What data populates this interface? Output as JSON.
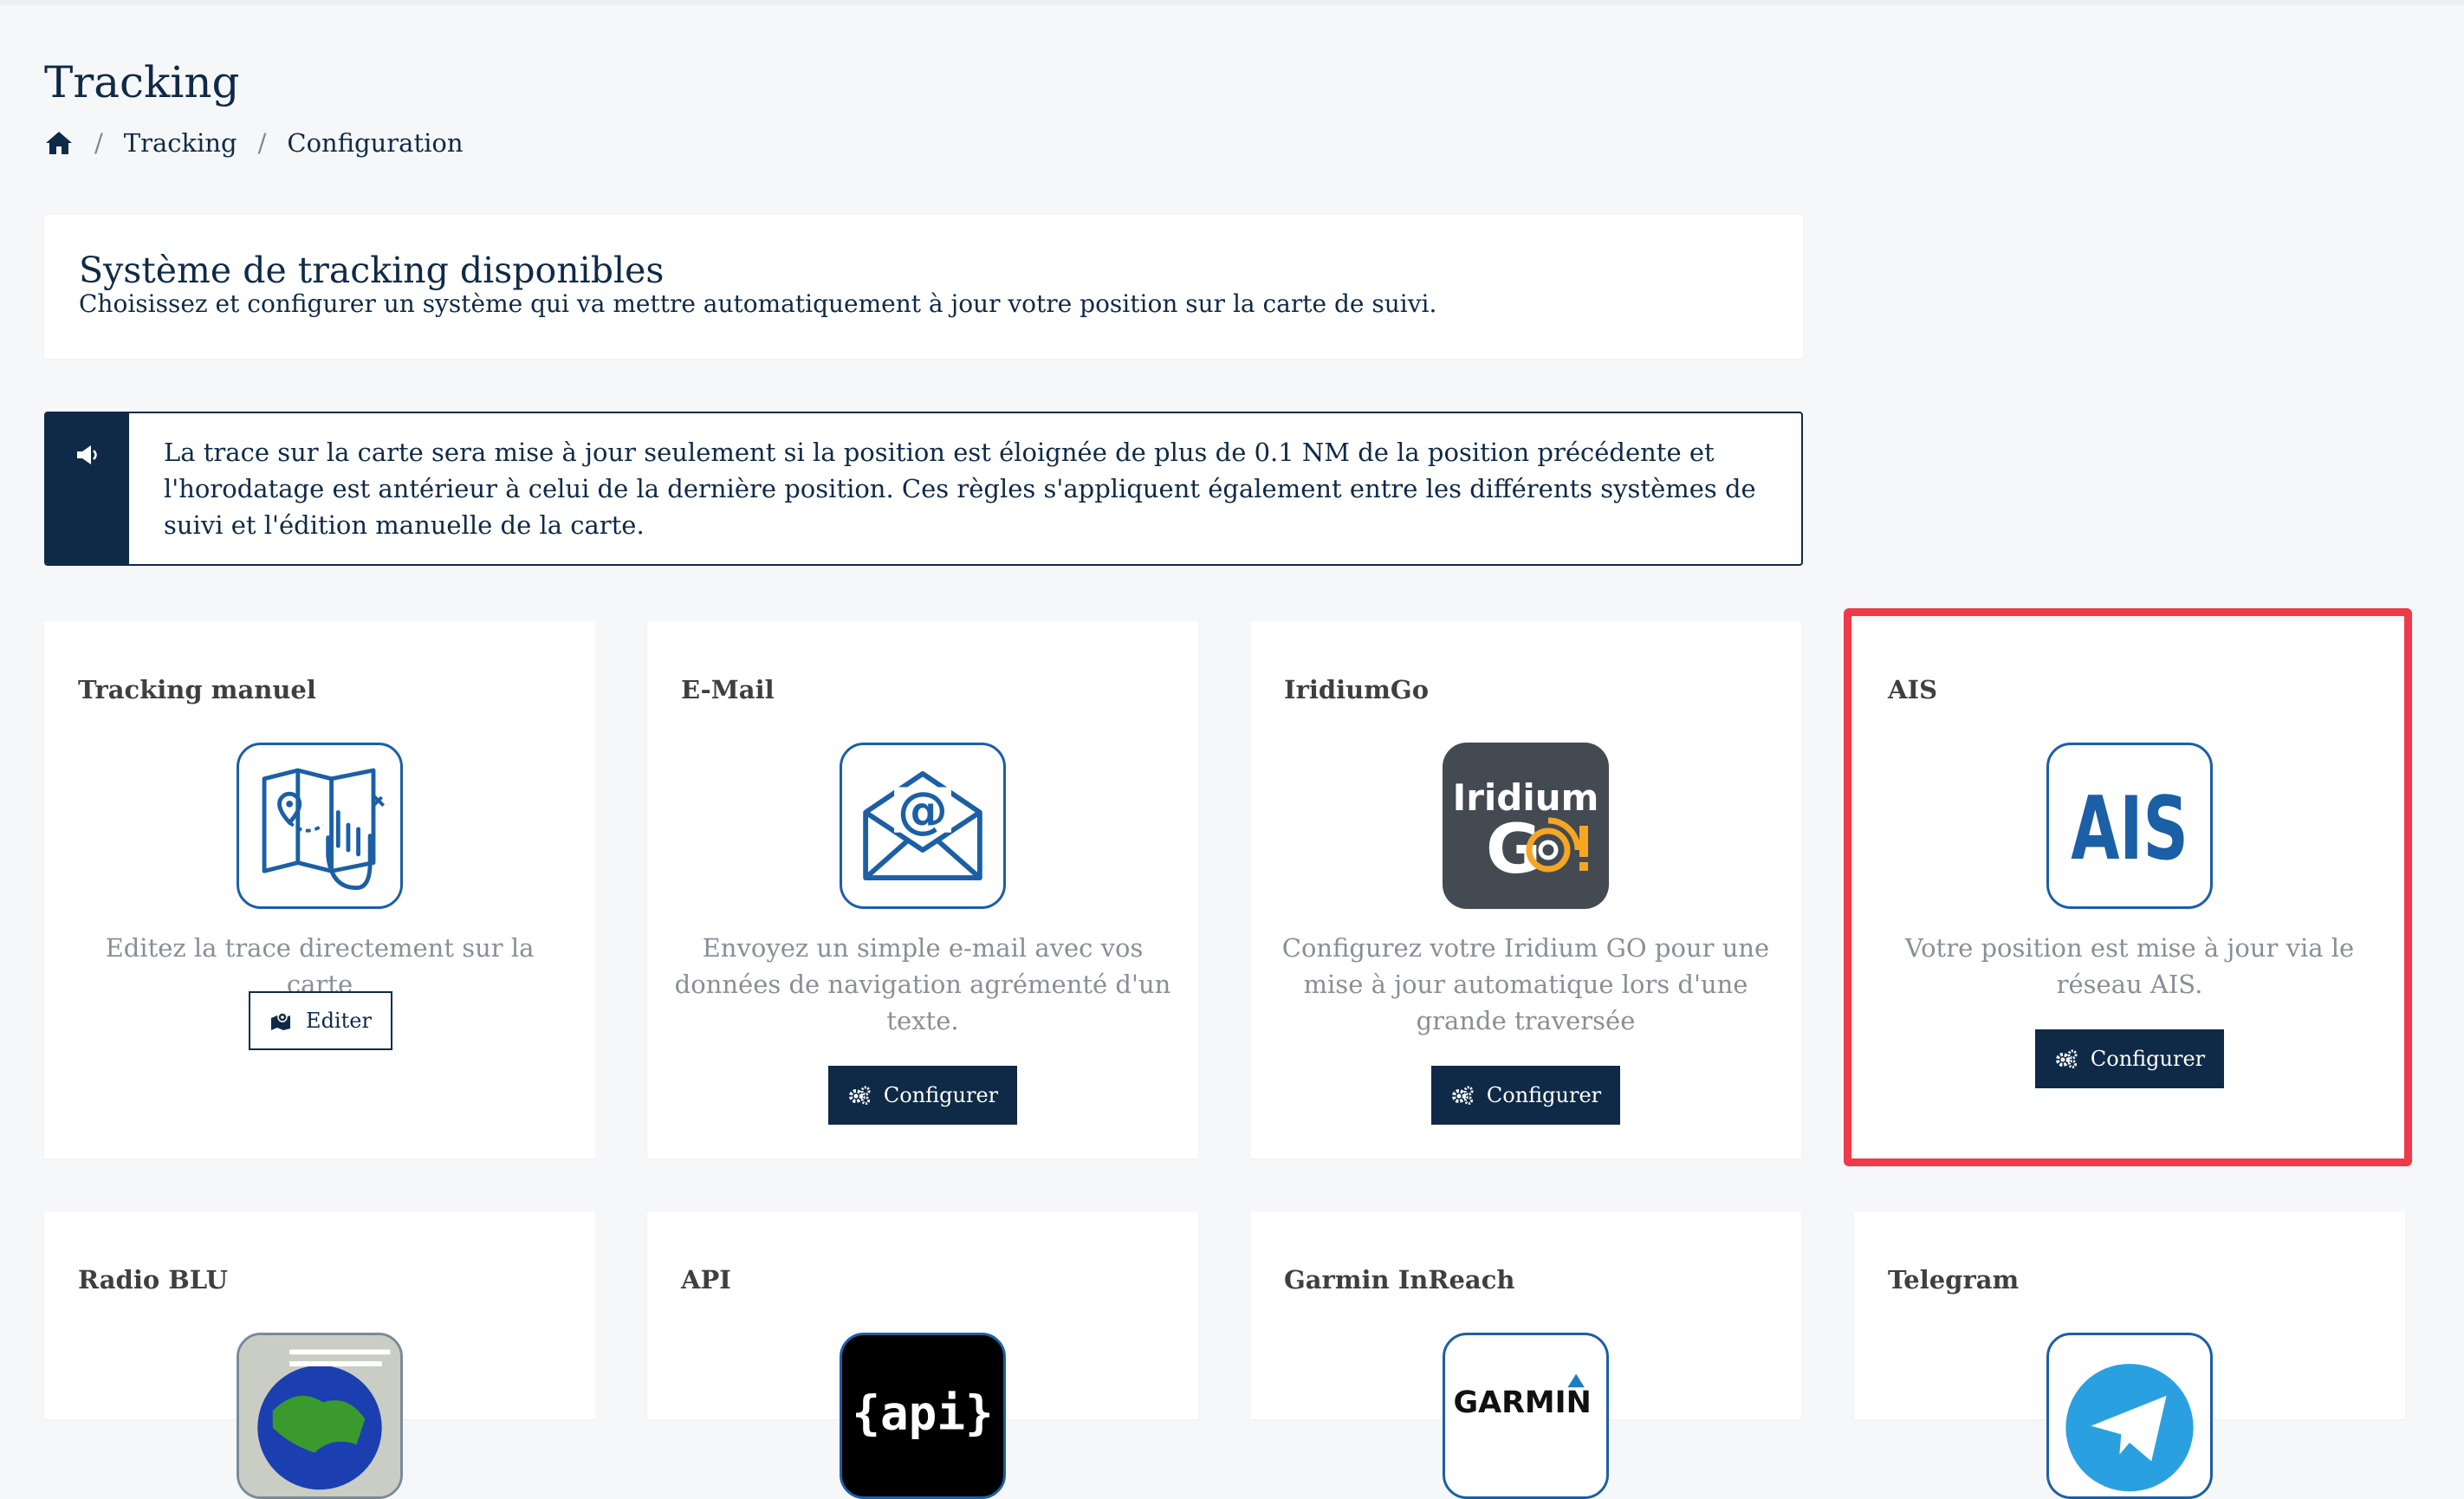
{
  "page": {
    "title": "Tracking",
    "breadcrumb": [
      "Tracking",
      "Configuration"
    ]
  },
  "intro": {
    "heading": "Système de tracking disponibles",
    "text": "Choisissez et configurer un système qui va mettre automatiquement à jour votre position sur la carte de suivi."
  },
  "notice": {
    "icon": "megaphone-icon",
    "text": "La trace sur la carte sera mise à jour seulement si la position est éloignée de plus de 0.1 NM de la position précédente et l'horodatage est antérieur à celui de la dernière position. Ces règles s'appliquent également entre les différents systèmes de suivi et l'édition manuelle de la carte."
  },
  "cards": [
    {
      "title": "Tracking manuel",
      "icon": "map-hand-icon",
      "desc": "Editez la trace directement sur la carte",
      "button": "Editer",
      "button_icon": "map-marker-icon"
    },
    {
      "title": "E-Mail",
      "icon": "email-envelope-icon",
      "desc": "Envoyez un simple e-mail avec vos données de navigation agrémenté d'un texte.",
      "button": "Configurer",
      "button_icon": "cogs-icon"
    },
    {
      "title": "IridiumGo",
      "icon": "iridium-go-logo",
      "logo_text_top": "Iridium",
      "logo_text_bottom": "GO!",
      "desc": "Configurez votre Iridium GO pour une mise à jour automatique lors d'une grande traversée",
      "button": "Configurer",
      "button_icon": "cogs-icon"
    },
    {
      "title": "AIS",
      "icon": "ais-logo",
      "logo_text": "AIS",
      "desc": "Votre position est mise à jour via le réseau AIS.",
      "button": "Configurer",
      "button_icon": "cogs-icon"
    },
    {
      "title": "Radio BLU",
      "icon": "radio-blu-icon"
    },
    {
      "title": "API",
      "icon": "api-logo",
      "logo_text": "{api}"
    },
    {
      "title": "Garmin InReach",
      "icon": "garmin-logo",
      "logo_text": "GARMIN"
    },
    {
      "title": "Telegram",
      "icon": "telegram-logo"
    }
  ],
  "colors": {
    "primary": "#0f2a47",
    "accent_blue": "#1b5fa6",
    "highlight": "#ef3a4a",
    "muted_text": "#8a8f96",
    "background": "#f6f7f9"
  }
}
